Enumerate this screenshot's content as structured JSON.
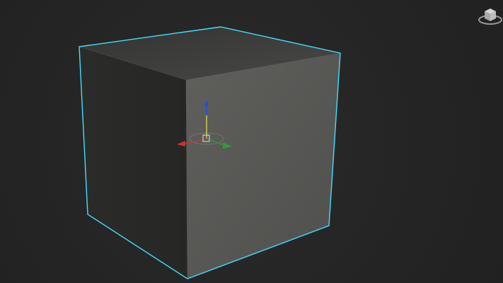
{
  "viewport": {
    "background": "#262626"
  },
  "object": {
    "type": "cube",
    "selected": true,
    "selection_color": "#3fe0ff",
    "top_face_color": "#3d3d3b",
    "front_face_color": "#5b5c58",
    "left_face_color": "#2a2b29"
  },
  "gizmo": {
    "icon": "transform-gizmo-icon",
    "axes": [
      {
        "name": "X",
        "color": "#d03030"
      },
      {
        "name": "Y",
        "color": "#2a9d3a"
      },
      {
        "name": "Z",
        "color": "#2a4bd8"
      }
    ],
    "center_color": "#e0e0e0",
    "up_stem_color": "#e8e34a"
  },
  "viewcube": {
    "icon": "viewcube-icon"
  }
}
